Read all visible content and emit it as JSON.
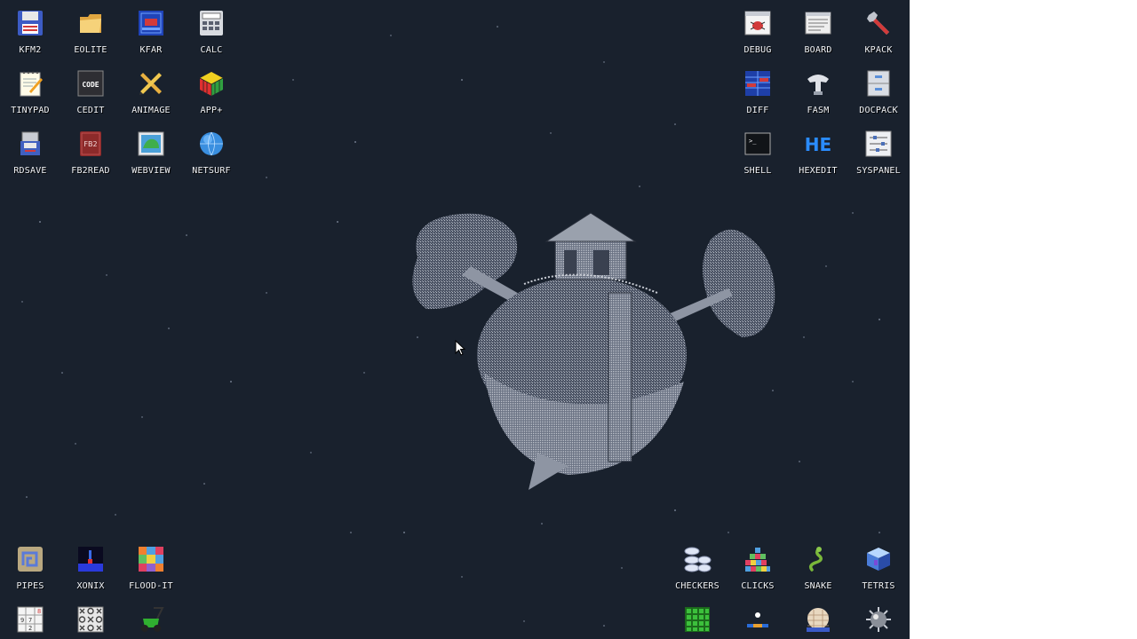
{
  "desktop": {
    "background_color": "#19212d",
    "wallpaper": "planet-treehouse"
  },
  "icons": {
    "kfm2": {
      "label": "KFM2",
      "icon": "floppy-disk-icon"
    },
    "eolite": {
      "label": "EOLITE",
      "icon": "folder-icon"
    },
    "kfar": {
      "label": "KFAR",
      "icon": "archive-icon"
    },
    "calc": {
      "label": "CALC",
      "icon": "calculator-icon"
    },
    "tinypad": {
      "label": "TINYPAD",
      "icon": "notepad-icon"
    },
    "cedit": {
      "label": "CEDIT",
      "icon": "code-editor-icon",
      "badge": "CODE"
    },
    "animage": {
      "label": "ANIMAGE",
      "icon": "pencil-ruler-icon"
    },
    "appplus": {
      "label": "APP+",
      "icon": "rubik-cube-icon"
    },
    "rdsave": {
      "label": "RDSAVE",
      "icon": "disk-save-icon"
    },
    "fb2read": {
      "label": "FB2READ",
      "icon": "book-icon",
      "badge": "FB2"
    },
    "webview": {
      "label": "WEBVIEW",
      "icon": "web-map-icon"
    },
    "netsurf": {
      "label": "NETSURF",
      "icon": "globe-icon"
    },
    "debug": {
      "label": "DEBUG",
      "icon": "bug-window-icon"
    },
    "board": {
      "label": "BOARD",
      "icon": "text-board-icon"
    },
    "kpack": {
      "label": "KPACK",
      "icon": "wrench-icon"
    },
    "diff": {
      "label": "DIFF",
      "icon": "diff-table-icon"
    },
    "fasm": {
      "label": "FASM",
      "icon": "fasm-anvil-icon"
    },
    "docpack": {
      "label": "DOCPACK",
      "icon": "cabinet-icon"
    },
    "shell": {
      "label": "SHELL",
      "icon": "terminal-icon",
      "badge": ">_"
    },
    "hexedit": {
      "label": "HEXEDIT",
      "icon": "hex-editor-icon",
      "badge": "HE"
    },
    "syspanel": {
      "label": "SYSPANEL",
      "icon": "sliders-icon"
    },
    "pipes": {
      "label": "PIPES",
      "icon": "pipes-game-icon"
    },
    "xonix": {
      "label": "XONIX",
      "icon": "xonix-game-icon"
    },
    "floodit": {
      "label": "FLOOD-IT",
      "icon": "color-grid-icon"
    },
    "checkers": {
      "label": "CHECKERS",
      "icon": "checkers-pieces-icon"
    },
    "clicks": {
      "label": "CLICKS",
      "icon": "color-blocks-icon"
    },
    "snake": {
      "label": "SNAKE",
      "icon": "snake-icon"
    },
    "tetris": {
      "label": "TETRIS",
      "icon": "tetris-cube-icon"
    },
    "sudoku": {
      "label": "",
      "icon": "sudoku-grid-icon",
      "badge_digits": [
        "9",
        "7",
        "8",
        "2"
      ]
    },
    "tictactoe": {
      "label": "",
      "icon": "tic-tac-toe-icon"
    },
    "lawnmower": {
      "label": "",
      "icon": "lawn-mower-icon"
    },
    "gridgame": {
      "label": "",
      "icon": "green-grid-icon"
    },
    "pong": {
      "label": "",
      "icon": "paddle-ball-icon"
    },
    "bricks": {
      "label": "",
      "icon": "brick-ball-icon"
    },
    "mine": {
      "label": "",
      "icon": "mine-icon"
    }
  }
}
